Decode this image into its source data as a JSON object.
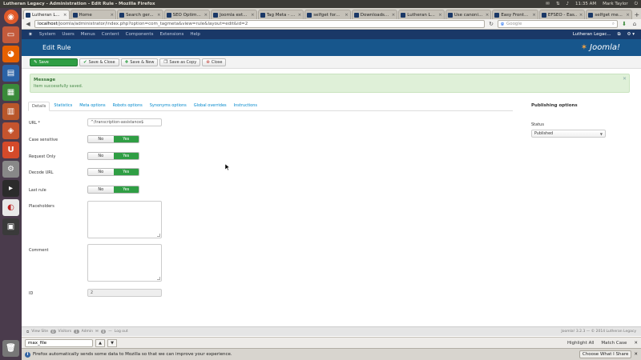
{
  "os": {
    "window_title": "Lutheran Legacy - Administration - Edit Rule - Mozilla Firefox",
    "clock": "11:35 AM",
    "user": "Mark Taylor"
  },
  "browser": {
    "tabs": [
      {
        "label": "Lutheran L..."
      },
      {
        "label": "Home"
      },
      {
        "label": "Search ger..."
      },
      {
        "label": "SEO Optim..."
      },
      {
        "label": "Joomla ext..."
      },
      {
        "label": "Tag Meta - ..."
      },
      {
        "label": "selfget for..."
      },
      {
        "label": "Downloads..."
      },
      {
        "label": "Lutheran L..."
      },
      {
        "label": "Use canoni..."
      },
      {
        "label": "Easy Front..."
      },
      {
        "label": "EFSEO - Eas..."
      },
      {
        "label": "selfget me..."
      }
    ],
    "url_host": "localhost",
    "url_path": "/joomla/administrator/index.php?option=com_tagmeta&view=rule&layout=edit&id=2",
    "search_placeholder": "Google"
  },
  "joomla": {
    "nav": [
      "System",
      "Users",
      "Menus",
      "Content",
      "Components",
      "Extensions",
      "Help"
    ],
    "site_name": "Lutheran Legac...",
    "page_title": "Edit Rule",
    "brand": "Joomla!",
    "toolbar": {
      "save": "Save",
      "save_close": "Save & Close",
      "save_new": "Save & New",
      "save_copy": "Save as Copy",
      "close": "Close"
    },
    "message": {
      "heading": "Message",
      "body": "Item successfully saved."
    },
    "tabs": [
      "Details",
      "Statistics",
      "Meta options",
      "Robots options",
      "Synonyms options",
      "Global overrides",
      "Instructions"
    ],
    "form": {
      "url_label": "URL *",
      "url_value": "^/transcription-assistance$",
      "case_label": "Case sensitive",
      "request_label": "Request Only",
      "decode_label": "Decode URL",
      "last_label": "Last rule",
      "no": "No",
      "yes": "Yes",
      "placeholders_label": "Placeholders",
      "comment_label": "Comment",
      "id_label": "ID",
      "id_value": "2"
    },
    "publishing": {
      "heading": "Publishing options",
      "status_label": "Status",
      "status_value": "Published"
    },
    "footer": {
      "view_site": "View Site",
      "visitors_count": "0",
      "visitors": "Visitors",
      "admins_count": "1",
      "admin": "Admin",
      "msgs_count": "0",
      "logout": "Log out",
      "copyright": "Joomla! 3.2.3 — © 2014 Lutheran Legacy"
    }
  },
  "findbar": {
    "value": "max_file",
    "highlight_all": "Highlight All",
    "match_case": "Match Case"
  },
  "notification": {
    "text": "Firefox automatically sends some data to Mozilla so that we can improve your experience.",
    "button": "Choose What I Share"
  },
  "colors": {
    "joomla_nav": "#1a3867",
    "joomla_header": "#17568c",
    "save_green": "#2f9e44",
    "message_bg": "#dff0d8",
    "launcher": "#4a3b4c"
  }
}
